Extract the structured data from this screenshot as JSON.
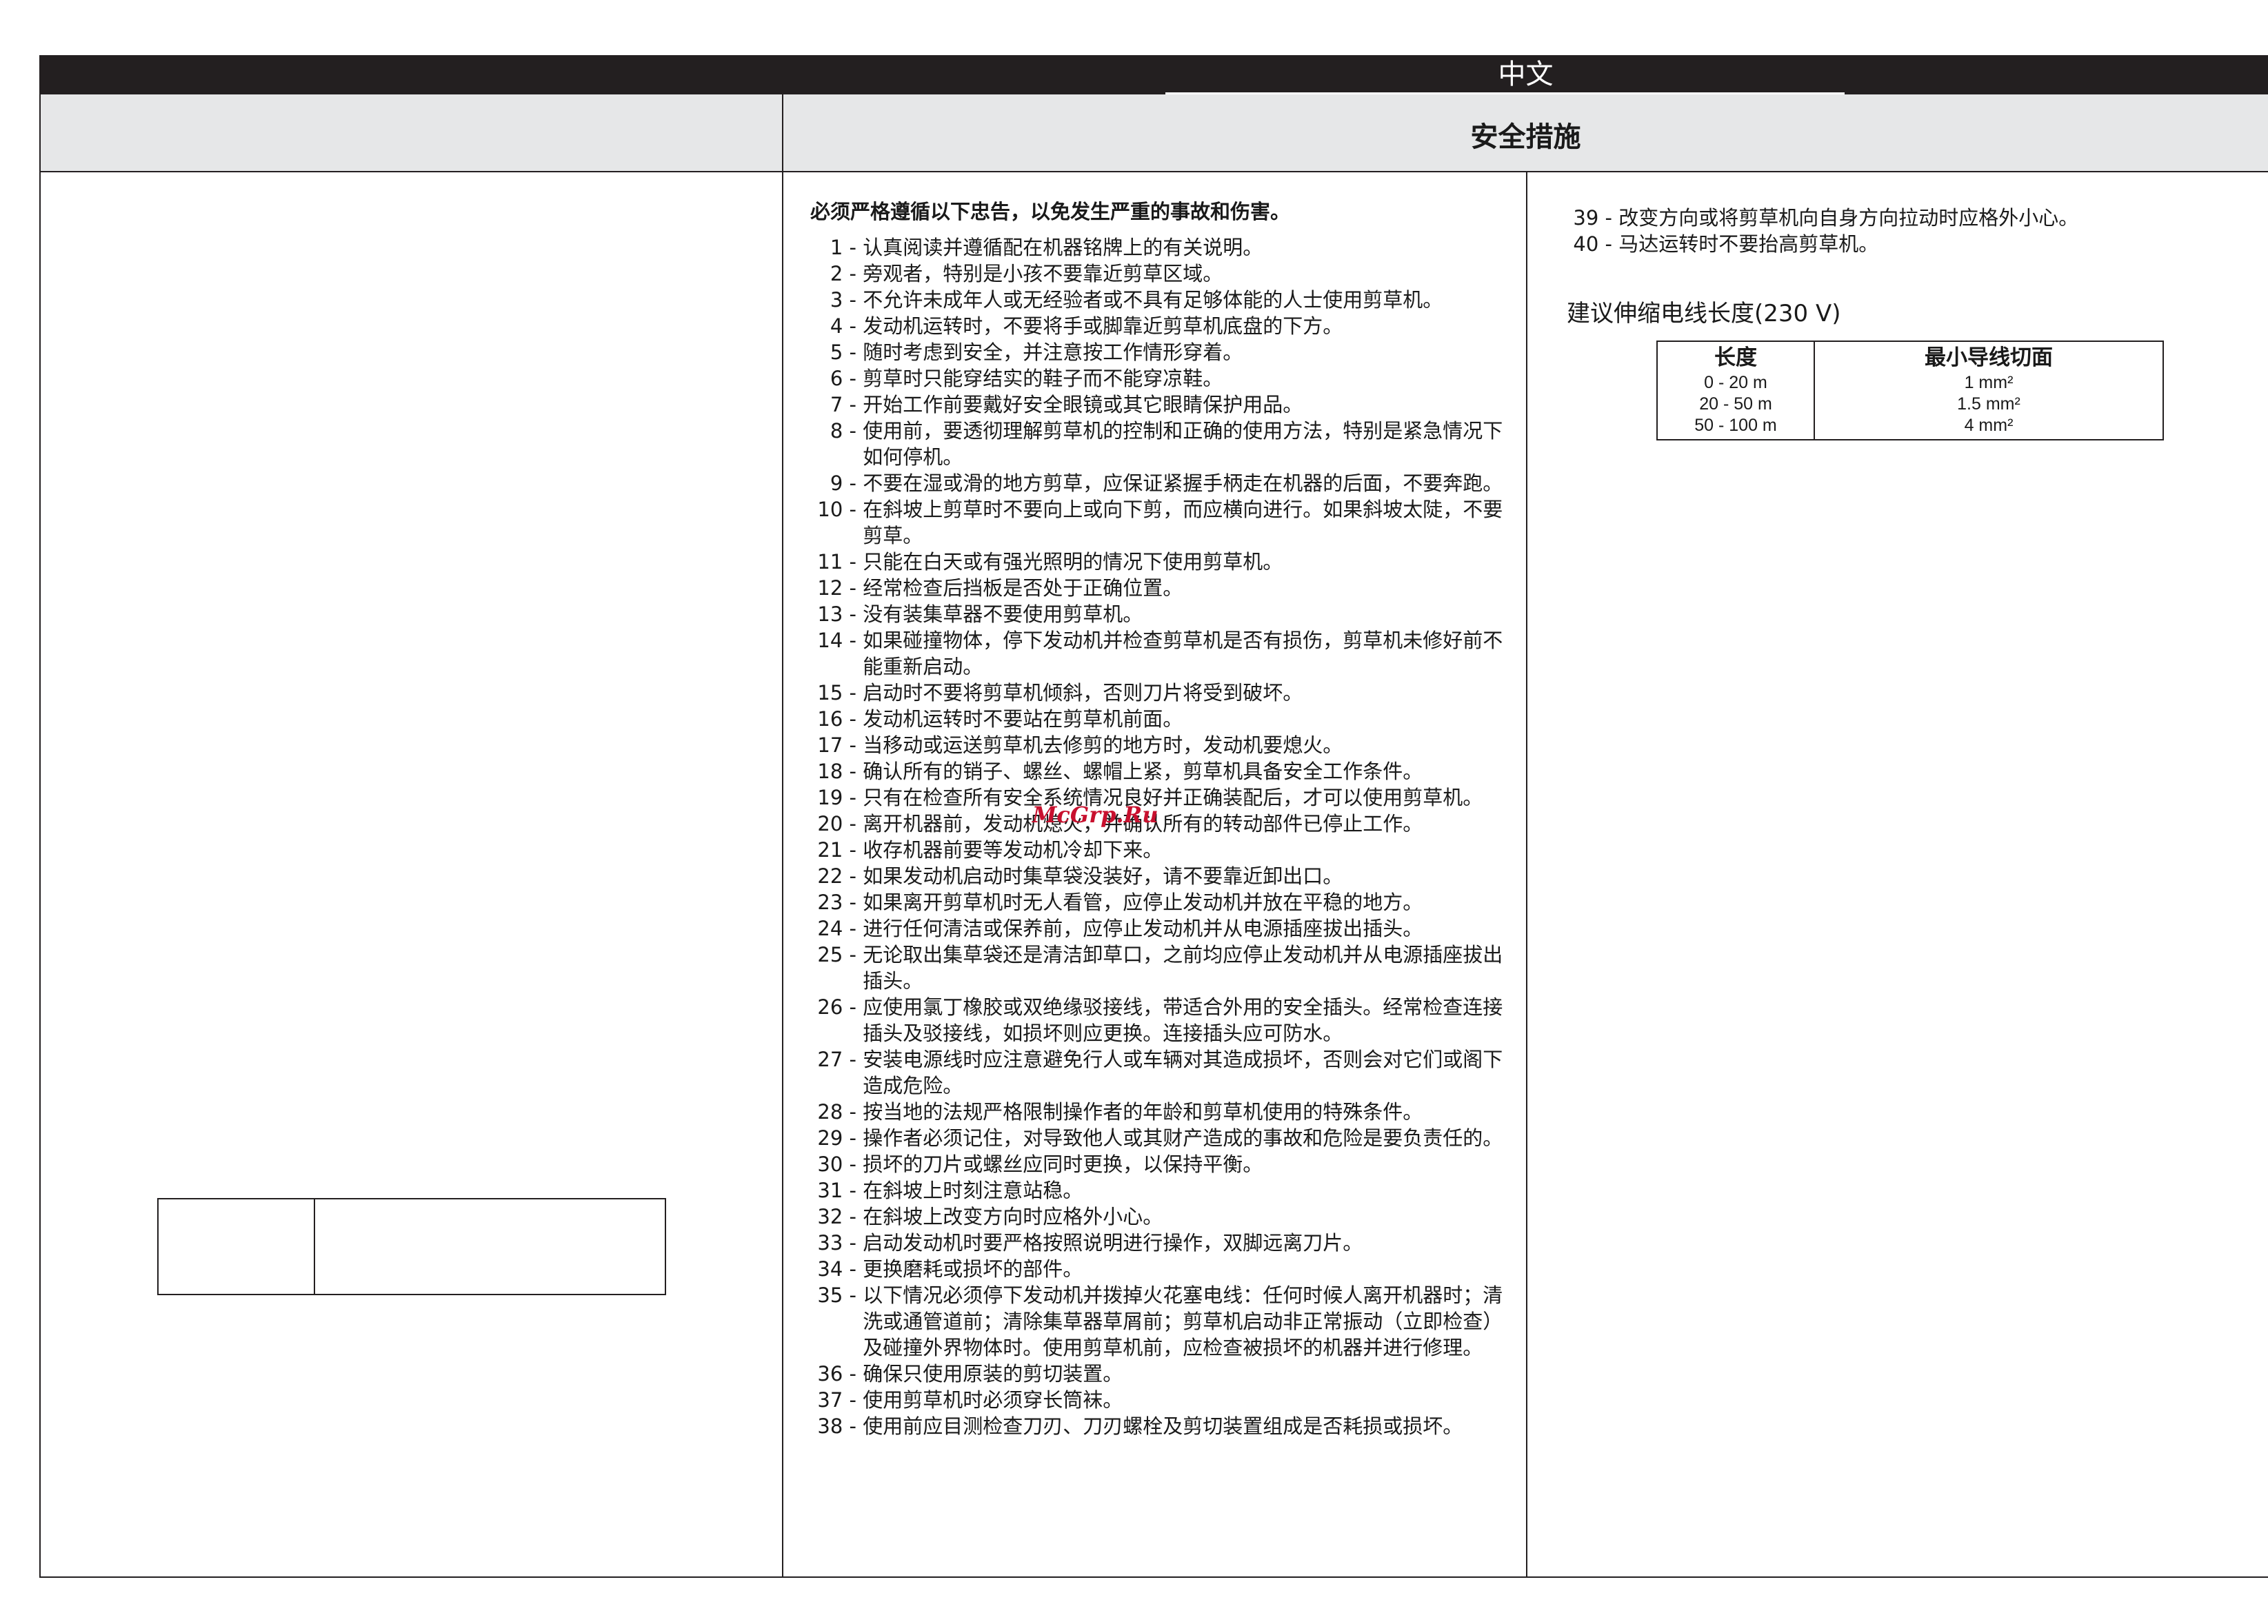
{
  "header": {
    "language": "中文",
    "section_title": "安全措施"
  },
  "intro": "必须严格遵循以下忠告，以免发生严重的事故和伤害。",
  "rules": [
    {
      "n": "1 -",
      "t": "认真阅读并遵循配在机器铭牌上的有关说明。"
    },
    {
      "n": "2 -",
      "t": "旁观者，特别是小孩不要靠近剪草区域。"
    },
    {
      "n": "3 -",
      "t": "不允许未成年人或无经验者或不具有足够体能的人士使用剪草机。"
    },
    {
      "n": "4 -",
      "t": "发动机运转时，不要将手或脚靠近剪草机底盘的下方。"
    },
    {
      "n": "5 -",
      "t": "随时考虑到安全，并注意按工作情形穿着。"
    },
    {
      "n": "6 -",
      "t": "剪草时只能穿结实的鞋子而不能穿凉鞋。"
    },
    {
      "n": "7 -",
      "t": "开始工作前要戴好安全眼镜或其它眼睛保护用品。"
    },
    {
      "n": "8 -",
      "t": "使用前，要透彻理解剪草机的控制和正确的使用方法，特别是紧急情况下如何停机。"
    },
    {
      "n": "9 -",
      "t": "不要在湿或滑的地方剪草，应保证紧握手柄走在机器的后面，不要奔跑。"
    },
    {
      "n": "10 -",
      "t": "在斜坡上剪草时不要向上或向下剪，而应横向进行。如果斜坡太陡，不要剪草。"
    },
    {
      "n": "11 -",
      "t": "只能在白天或有强光照明的情况下使用剪草机。"
    },
    {
      "n": "12 -",
      "t": "经常检查后挡板是否处于正确位置。"
    },
    {
      "n": "13 -",
      "t": "没有装集草器不要使用剪草机。"
    },
    {
      "n": "14 -",
      "t": "如果碰撞物体，停下发动机并检查剪草机是否有损伤，剪草机未修好前不能重新启动。"
    },
    {
      "n": "15 -",
      "t": "启动时不要将剪草机倾斜，否则刀片将受到破坏。"
    },
    {
      "n": "16 -",
      "t": "发动机运转时不要站在剪草机前面。"
    },
    {
      "n": "17 -",
      "t": "当移动或运送剪草机去修剪的地方时，发动机要熄火。"
    },
    {
      "n": "18 -",
      "t": "确认所有的销子、螺丝、螺帽上紧，剪草机具备安全工作条件。"
    },
    {
      "n": "19 -",
      "t": "只有在检查所有安全系统情况良好并正确装配后，才可以使用剪草机。"
    },
    {
      "n": "20 -",
      "t": "离开机器前，发动机熄火，并确认所有的转动部件已停止工作。"
    },
    {
      "n": "21 -",
      "t": "收存机器前要等发动机冷却下来。"
    },
    {
      "n": "22 -",
      "t": "如果发动机启动时集草袋没装好，请不要靠近卸出口。"
    },
    {
      "n": "23 -",
      "t": "如果离开剪草机时无人看管，应停止发动机并放在平稳的地方。"
    },
    {
      "n": "24 -",
      "t": "进行任何清洁或保养前，应停止发动机并从电源插座拔出插头。"
    },
    {
      "n": "25 -",
      "t": "无论取出集草袋还是清洁卸草口，之前均应停止发动机并从电源插座拔出插头。"
    },
    {
      "n": "26 -",
      "t": "应使用氯丁橡胶或双绝缘驳接线，带适合外用的安全插头。经常检查连接插头及驳接线，如损坏则应更换。连接插头应可防水。"
    },
    {
      "n": "27 -",
      "t": "安装电源线时应注意避免行人或车辆对其造成损坏，否则会对它们或阁下造成危险。"
    },
    {
      "n": "28 -",
      "t": "按当地的法规严格限制操作者的年龄和剪草机使用的特殊条件。"
    },
    {
      "n": "29 -",
      "t": "操作者必须记住，对导致他人或其财产造成的事故和危险是要负责任的。"
    },
    {
      "n": "30 -",
      "t": "损坏的刀片或螺丝应同时更换，以保持平衡。"
    },
    {
      "n": "31 -",
      "t": "在斜坡上时刻注意站稳。"
    },
    {
      "n": "32 -",
      "t": "在斜坡上改变方向时应格外小心。"
    },
    {
      "n": "33 -",
      "t": "启动发动机时要严格按照说明进行操作，双脚远离刀片。"
    },
    {
      "n": "34 -",
      "t": "更换磨耗或损坏的部件。"
    },
    {
      "n": "35 -",
      "t": "以下情况必须停下发动机并拨掉火花塞电线：任何时候人离开机器时；清洗或通管道前；清除集草器草屑前；剪草机启动非正常振动（立即检查）及碰撞外界物体时。使用剪草机前，应检查被损坏的机器并进行修理。"
    },
    {
      "n": "36 -",
      "t": "确保只使用原装的剪切装置。"
    },
    {
      "n": "37 -",
      "t": "使用剪草机时必须穿长筒袜。"
    },
    {
      "n": "38 -",
      "t": "使用前应目测检查刀刃、刀刃螺栓及剪切装置组成是否耗损或损坏。"
    }
  ],
  "rules_continued": [
    {
      "n": "39 -",
      "t": "改变方向或将剪草机向自身方向拉动时应格外小心。"
    },
    {
      "n": "40 -",
      "t": "马达运转时不要抬高剪草机。"
    }
  ],
  "cable_section": {
    "title": "建议伸缩电线长度(230 V)",
    "col_length": "长度",
    "col_section": "最小导线切面",
    "lengths": [
      "0 - 20 m",
      "20 - 50 m",
      "50 - 100 m"
    ],
    "sections": [
      "1 mm²",
      "1.5 mm²",
      "4 mm²"
    ]
  },
  "watermark": "McGrp.Ru"
}
